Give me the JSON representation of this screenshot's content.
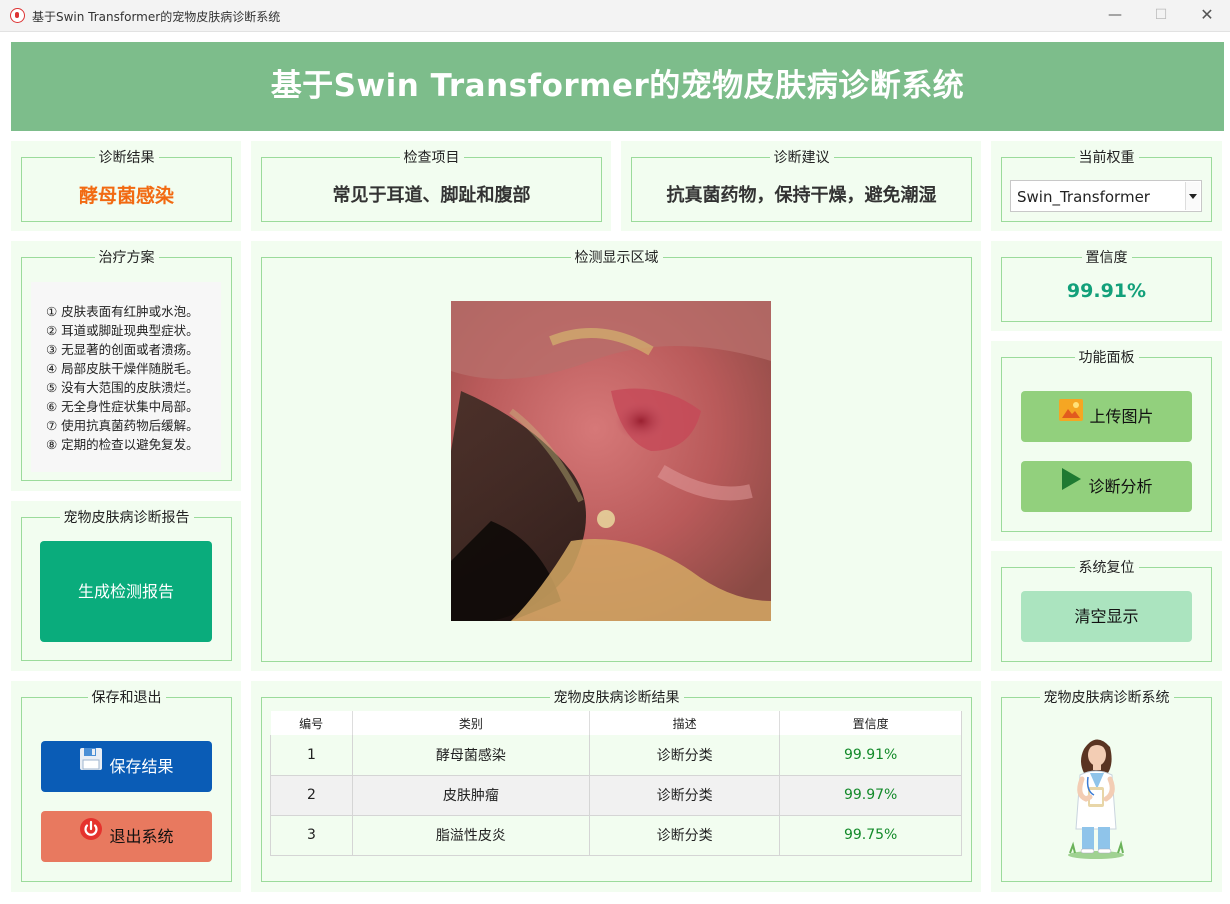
{
  "window": {
    "title": "基于Swin Transformer的宠物皮肤病诊断系统",
    "controls": {
      "minimize": "—",
      "maximize": "☐",
      "close": "✕"
    }
  },
  "banner": {
    "title": "基于Swin Transformer的宠物皮肤病诊断系统"
  },
  "diagnosis_result": {
    "title": "诊断结果",
    "value": "酵母菌感染"
  },
  "exam_item": {
    "title": "检查项目",
    "value": "常见于耳道、脚趾和腹部"
  },
  "diagnosis_advice": {
    "title": "诊断建议",
    "value": "抗真菌药物，保持干燥，避免潮湿"
  },
  "current_weight": {
    "title": "当前权重",
    "selected": "Swin_Transformer"
  },
  "treatment": {
    "title": "治疗方案",
    "items": [
      "① 皮肤表面有红肿或水泡。",
      "② 耳道或脚趾现典型症状。",
      "③ 无显著的创面或者溃疡。",
      "④ 局部皮肤干燥伴随脱毛。",
      "⑤ 没有大范围的皮肤溃烂。",
      "⑥ 无全身性症状集中局部。",
      "⑦ 使用抗真菌药物后缓解。",
      "⑧ 定期的检查以避免复发。"
    ]
  },
  "detection_area": {
    "title": "检测显示区域"
  },
  "confidence": {
    "title": "置信度",
    "value": "99.91%"
  },
  "function_panel": {
    "title": "功能面板",
    "upload_label": "上传图片",
    "analyze_label": "诊断分析"
  },
  "system_reset": {
    "title": "系统复位",
    "clear_label": "清空显示"
  },
  "report": {
    "title": "宠物皮肤病诊断报告",
    "generate_label": "生成检测报告"
  },
  "save_exit": {
    "title": "保存和退出",
    "save_label": "保存结果",
    "exit_label": "退出系统"
  },
  "results_table": {
    "title": "宠物皮肤病诊断结果",
    "headers": [
      "编号",
      "类别",
      "描述",
      "置信度"
    ],
    "rows": [
      [
        "1",
        "酵母菌感染",
        "诊断分类",
        "99.91%"
      ],
      [
        "2",
        "皮肤肿瘤",
        "诊断分类",
        "99.97%"
      ],
      [
        "3",
        "脂溢性皮炎",
        "诊断分类",
        "99.75%"
      ]
    ]
  },
  "about": {
    "title": "宠物皮肤病诊断系统"
  },
  "colors": {
    "banner": "#7dbd8b",
    "panel_bg": "#f2fdf0",
    "group_border": "#9bdb9b",
    "result_orange": "#f26a12",
    "confidence_green": "#12a07a",
    "report_button": "#0aac7c",
    "save_button": "#0a5cb6",
    "exit_button": "#e8795f",
    "function_button": "#92d07d",
    "clear_button": "#abe4bf"
  }
}
